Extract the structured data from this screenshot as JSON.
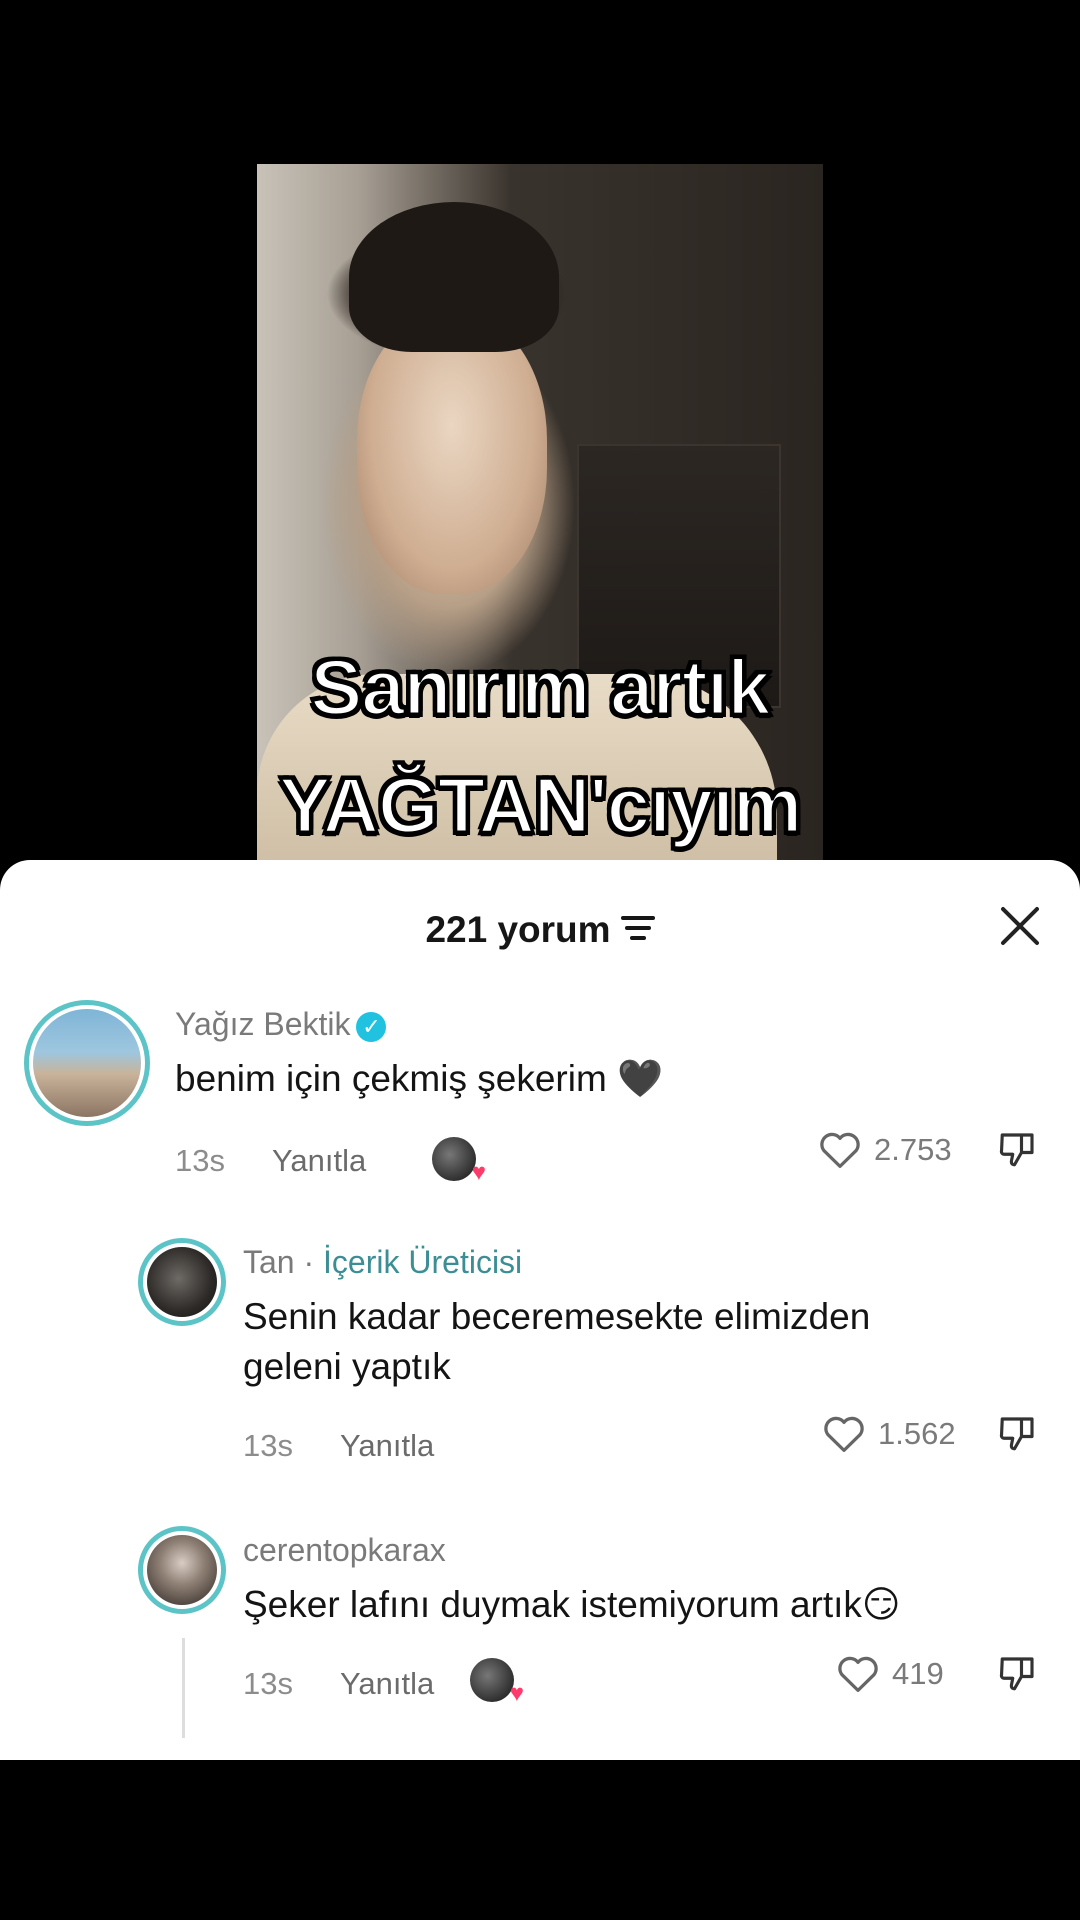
{
  "video": {
    "caption_line1": "Sanırım artık",
    "caption_line2": "YAĞTAN'cıyım"
  },
  "comments_sheet": {
    "count_label": "221 yorum",
    "filter_icon": "filter-lines-icon",
    "close_icon": "close-x-icon",
    "comments": [
      {
        "username": "Yağız Bektik",
        "verified": true,
        "text": "benim için çekmiş şekerim 🖤",
        "time": "13s",
        "reply_label": "Yanıtla",
        "likes": "2.753",
        "creator_liked": true
      },
      {
        "username": "Tan",
        "separator": " · ",
        "role_tag": "İçerik Üreticisi",
        "text_line1": "Senin kadar beceremesekte elimizden",
        "text_line2": "geleni yaptık",
        "time": "13s",
        "reply_label": "Yanıtla",
        "likes": "1.562"
      },
      {
        "username": "cerentopkarax",
        "text": "Şeker lafını duymak istemiyorum artık😏",
        "time": "13s",
        "reply_label": "Yanıtla",
        "likes": "419",
        "creator_liked": true
      }
    ]
  },
  "colors": {
    "avatar_ring": "#5cc4c6",
    "verified_badge": "#20c2e0",
    "creator_tag": "#3b8e93",
    "creator_heart": "#ff3b6b"
  }
}
